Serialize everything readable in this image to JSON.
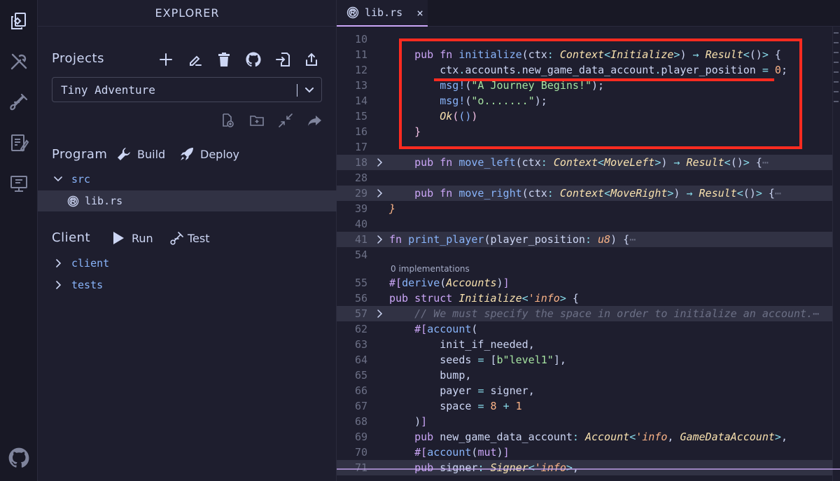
{
  "explorer": {
    "title": "EXPLORER",
    "projects_title": "Projects",
    "project_selected": "Tiny Adventure",
    "program_title": "Program",
    "build_label": "Build",
    "deploy_label": "Deploy",
    "program_tree": [
      {
        "name": "src",
        "type": "folder"
      },
      {
        "name": "lib.rs",
        "type": "file"
      }
    ],
    "client_title": "Client",
    "run_label": "Run",
    "test_label": "Test",
    "client_tree": [
      {
        "name": "client",
        "type": "folder"
      },
      {
        "name": "tests",
        "type": "folder"
      }
    ]
  },
  "editor": {
    "tab_label": "lib.rs",
    "tab_close": "×",
    "code_lens": "0 implementations",
    "line_numbers": [
      "10",
      "11",
      "12",
      "13",
      "14",
      "15",
      "16",
      "17",
      "18",
      "28",
      "29",
      "39",
      "40",
      "41",
      "54",
      "55",
      "56",
      "57",
      "62",
      "63",
      "64",
      "65",
      "66",
      "67",
      "68",
      "69",
      "70",
      "71"
    ],
    "ellipsis": "⋯"
  },
  "colors": {
    "accent": "#cba6f7",
    "annotation_red": "#ff2b20"
  }
}
